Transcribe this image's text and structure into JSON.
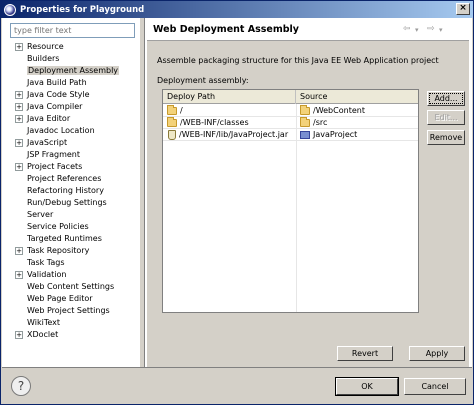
{
  "window": {
    "title": "Properties for Playground",
    "close_glyph": "×"
  },
  "filter": {
    "placeholder": "type filter text"
  },
  "tree": [
    {
      "label": "Resource",
      "expandable": true
    },
    {
      "label": "Builders",
      "expandable": false
    },
    {
      "label": "Deployment Assembly",
      "expandable": false,
      "selected": true
    },
    {
      "label": "Java Build Path",
      "expandable": false
    },
    {
      "label": "Java Code Style",
      "expandable": true
    },
    {
      "label": "Java Compiler",
      "expandable": true
    },
    {
      "label": "Java Editor",
      "expandable": true
    },
    {
      "label": "Javadoc Location",
      "expandable": false
    },
    {
      "label": "JavaScript",
      "expandable": true
    },
    {
      "label": "JSP Fragment",
      "expandable": false
    },
    {
      "label": "Project Facets",
      "expandable": true
    },
    {
      "label": "Project References",
      "expandable": false
    },
    {
      "label": "Refactoring History",
      "expandable": false
    },
    {
      "label": "Run/Debug Settings",
      "expandable": false
    },
    {
      "label": "Server",
      "expandable": false
    },
    {
      "label": "Service Policies",
      "expandable": false
    },
    {
      "label": "Targeted Runtimes",
      "expandable": false
    },
    {
      "label": "Task Repository",
      "expandable": true
    },
    {
      "label": "Task Tags",
      "expandable": false
    },
    {
      "label": "Validation",
      "expandable": true
    },
    {
      "label": "Web Content Settings",
      "expandable": false
    },
    {
      "label": "Web Page Editor",
      "expandable": false
    },
    {
      "label": "Web Project Settings",
      "expandable": false
    },
    {
      "label": "WikiText",
      "expandable": false
    },
    {
      "label": "XDoclet",
      "expandable": true
    }
  ],
  "page": {
    "title": "Web Deployment Assembly",
    "description": "Assemble packaging structure for this Java EE Web Application project",
    "assembly_label": "Deployment assembly:",
    "nav": {
      "back": "⇦",
      "back_menu": "▾",
      "forward": "⇨",
      "forward_menu": "▾"
    }
  },
  "table": {
    "columns": [
      "Deploy Path",
      "Source"
    ],
    "rows": [
      {
        "deploy_path": "/",
        "deploy_icon": "folder-icon",
        "source": "/WebContent",
        "source_icon": "folder-icon"
      },
      {
        "deploy_path": "/WEB-INF/classes",
        "deploy_icon": "folder-icon",
        "source": "/src",
        "source_icon": "folder-icon"
      },
      {
        "deploy_path": "/WEB-INF/lib/JavaProject.jar",
        "deploy_icon": "jar-icon",
        "source": "JavaProject",
        "source_icon": "project-icon"
      }
    ]
  },
  "buttons": {
    "add": "Add...",
    "edit": "Edit...",
    "remove": "Remove",
    "revert": "Revert",
    "apply": "Apply",
    "ok": "OK",
    "cancel": "Cancel"
  },
  "footer": {
    "help_glyph": "?"
  }
}
